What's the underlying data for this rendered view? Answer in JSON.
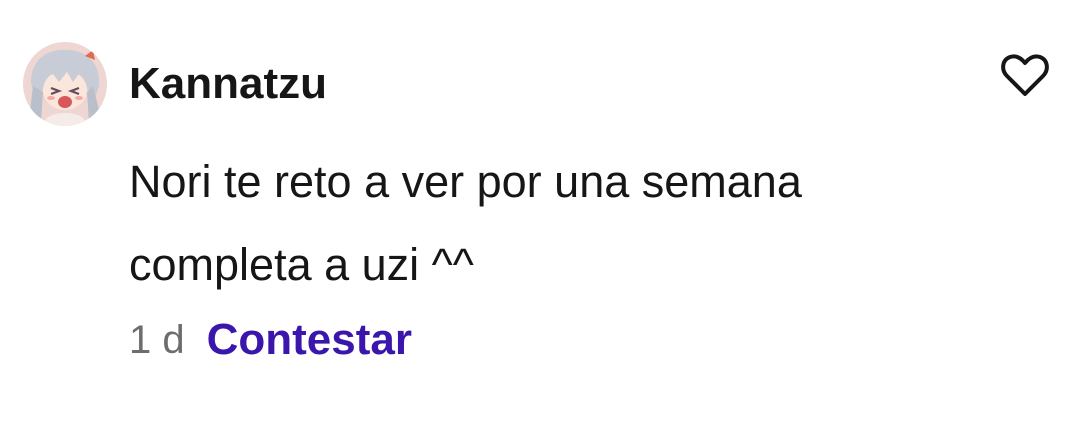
{
  "comment": {
    "author": "Kannatzu",
    "text": "Nori te reto a ver por una semana completa a uzi ^^",
    "age": "1 d",
    "reply_label": "Contestar",
    "avatar_icon": "anime-avatar",
    "like_icon": "heart-outline-icon"
  },
  "colors": {
    "author": "#161616",
    "text": "#161616",
    "age": "#6d6d6d",
    "reply": "#3b16ad",
    "background": "#ffffff"
  }
}
